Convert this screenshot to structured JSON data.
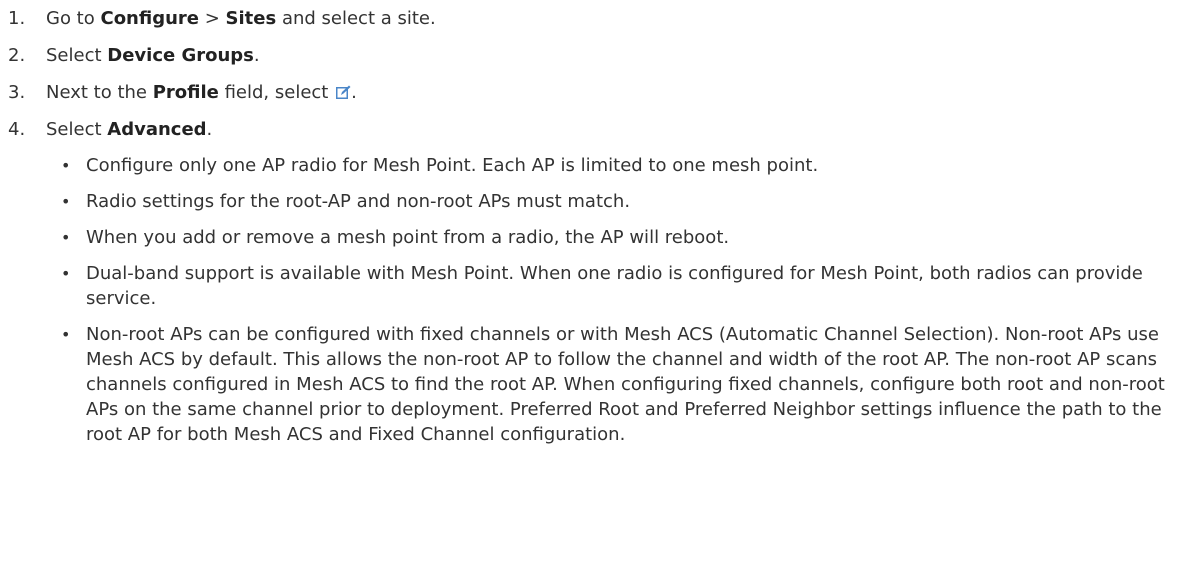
{
  "steps": [
    {
      "num": "1.",
      "t1": "Go to ",
      "b1": "Configure",
      "t2": " > ",
      "b2": "Sites",
      "t3": " and select a site."
    },
    {
      "num": "2.",
      "t1": "Select ",
      "b1": "Device Groups",
      "t2": "."
    },
    {
      "num": "3.",
      "t1": "Next to the ",
      "b1": "Profile",
      "t2": " field, select ",
      "t3": "."
    },
    {
      "num": "4.",
      "t1": "Select ",
      "b1": "Advanced",
      "t2": "."
    }
  ],
  "bullets": [
    "Configure only one AP radio for Mesh Point. Each AP is limited to one mesh point.",
    "Radio settings for the root-AP and non-root APs must match.",
    "When you add or remove a mesh point from a radio, the AP will reboot.",
    "Dual-band support is available with Mesh Point. When one radio is configured for Mesh Point, both radios can provide service.",
    "Non-root APs can be configured with fixed channels or with Mesh ACS (Automatic Channel Selection). Non-root APs use Mesh ACS by default. This allows the non-root AP to follow the channel and width of the root AP. The non-root AP scans channels configured in Mesh ACS to find the root AP. When configuring fixed channels, configure both root and non-root APs on the same channel prior to deployment. Preferred Root and Preferred Neighbor settings influence the path to the root AP for both Mesh ACS and Fixed Channel configuration."
  ],
  "icons": {
    "edit": "edit-icon",
    "accent": "#4a86c8"
  }
}
